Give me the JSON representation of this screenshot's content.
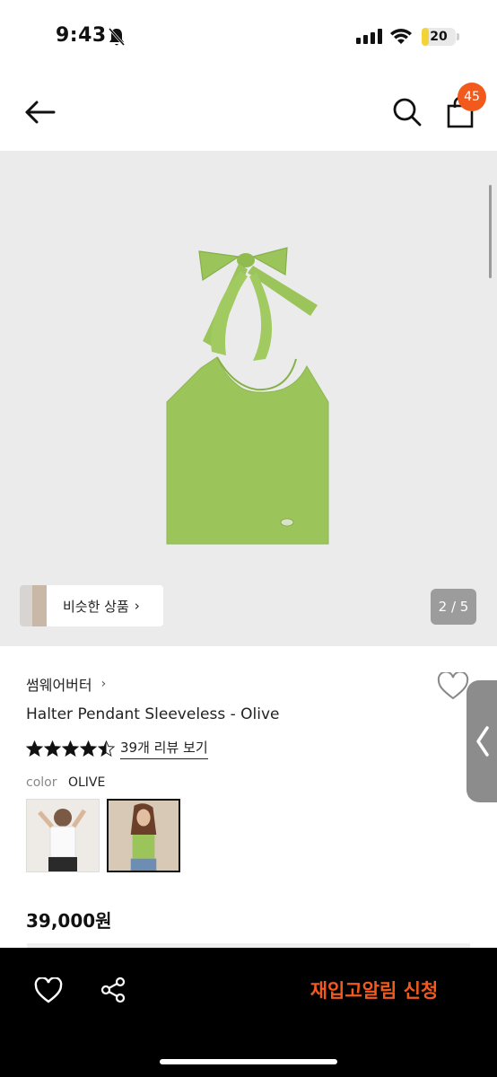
{
  "status_bar": {
    "time": "9:43",
    "battery": "20",
    "battery_level": 0.2
  },
  "header": {
    "cart_count": "45"
  },
  "gallery": {
    "similar_label": "비슷한 상품",
    "similar_chevron": "›",
    "page_counter": "2 / 5",
    "product_color": "#9bc55a"
  },
  "product": {
    "brand": "썸웨어버터",
    "brand_chevron": "›",
    "title": "Halter Pendant Sleeveless - Olive",
    "rating": 4.5,
    "reviews_link": "39개 리뷰 보기",
    "color_label": "color",
    "color_value": "OLIVE",
    "price": "39,000원"
  },
  "bottom_bar": {
    "restock_label": "재입고알림 신청",
    "accent_color": "#f25a1d"
  }
}
